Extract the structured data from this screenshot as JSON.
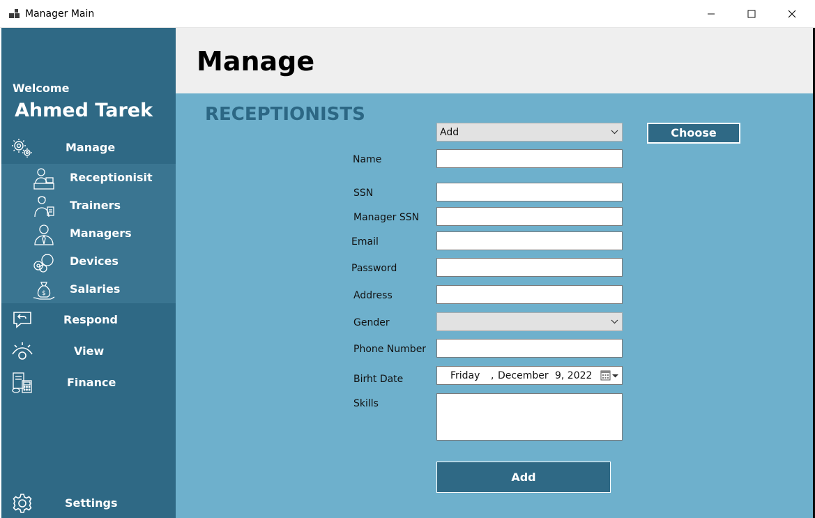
{
  "window": {
    "title": "Manager Main"
  },
  "sidebar": {
    "welcome": "Welcome",
    "username": "Ahmed Tarek",
    "manage_label": "Manage",
    "submenu": [
      {
        "label": "Receptionisit",
        "icon": "receptionist-icon"
      },
      {
        "label": "Trainers",
        "icon": "trainer-icon"
      },
      {
        "label": "Managers",
        "icon": "manager-icon"
      },
      {
        "label": "Devices",
        "icon": "dumbbell-icon"
      },
      {
        "label": "Salaries",
        "icon": "money-bag-icon"
      }
    ],
    "respond_label": "Respond",
    "view_label": "View",
    "finance_label": "Finance",
    "settings_label": "Settings"
  },
  "header": {
    "title": "Manage"
  },
  "form": {
    "section_title": "RECEPTIONISTS",
    "mode_value": "Add",
    "choose_label": "Choose",
    "labels": {
      "name": "Name",
      "ssn": "SSN",
      "manager_ssn": "Manager SSN",
      "email": "Email",
      "password": "Password",
      "address": "Address",
      "gender": "Gender",
      "phone": "Phone Number",
      "birth_date": "Birht Date",
      "skills": "Skills"
    },
    "values": {
      "name": "",
      "ssn": "",
      "manager_ssn": "",
      "email": "",
      "password": "",
      "address": "",
      "gender": "",
      "phone": "",
      "skills": ""
    },
    "birth_date": {
      "weekday": "Friday",
      "comma": ",",
      "month": "December",
      "day_year": "9, 2022"
    },
    "submit_label": "Add"
  },
  "colors": {
    "sidebar": "#2f6985",
    "submenu": "#3a7591",
    "content": "#6eb0cc",
    "header": "#efefef",
    "section_title": "#2c6784"
  }
}
